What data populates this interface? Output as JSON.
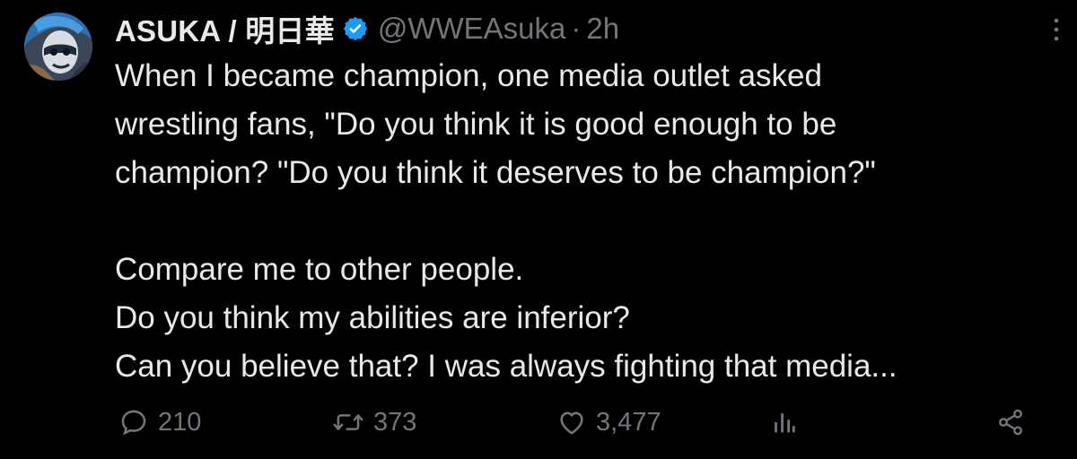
{
  "tweet": {
    "author": {
      "display_name": "ASUKA / 明日華",
      "handle": "@WWEAsuka",
      "verified_icon": "verified-badge-icon"
    },
    "separator": "·",
    "time": "2h",
    "more_icon": "more-vertical-icon",
    "body": "When I became champion, one media outlet asked\nwrestling fans, \"Do you think it is good enough to be\nchampion? \"Do you think it deserves to be champion?\"\n\nCompare me to other people.\nDo you think my abilities are inferior?\nCan you believe that? I was always fighting that media...",
    "actions": {
      "reply_count": "210",
      "retweet_count": "373",
      "like_count": "3,477"
    }
  },
  "colors": {
    "background": "#000000",
    "text_primary": "#e7e9ea",
    "text_secondary": "#71767b",
    "verified": "#1d9bf0"
  }
}
